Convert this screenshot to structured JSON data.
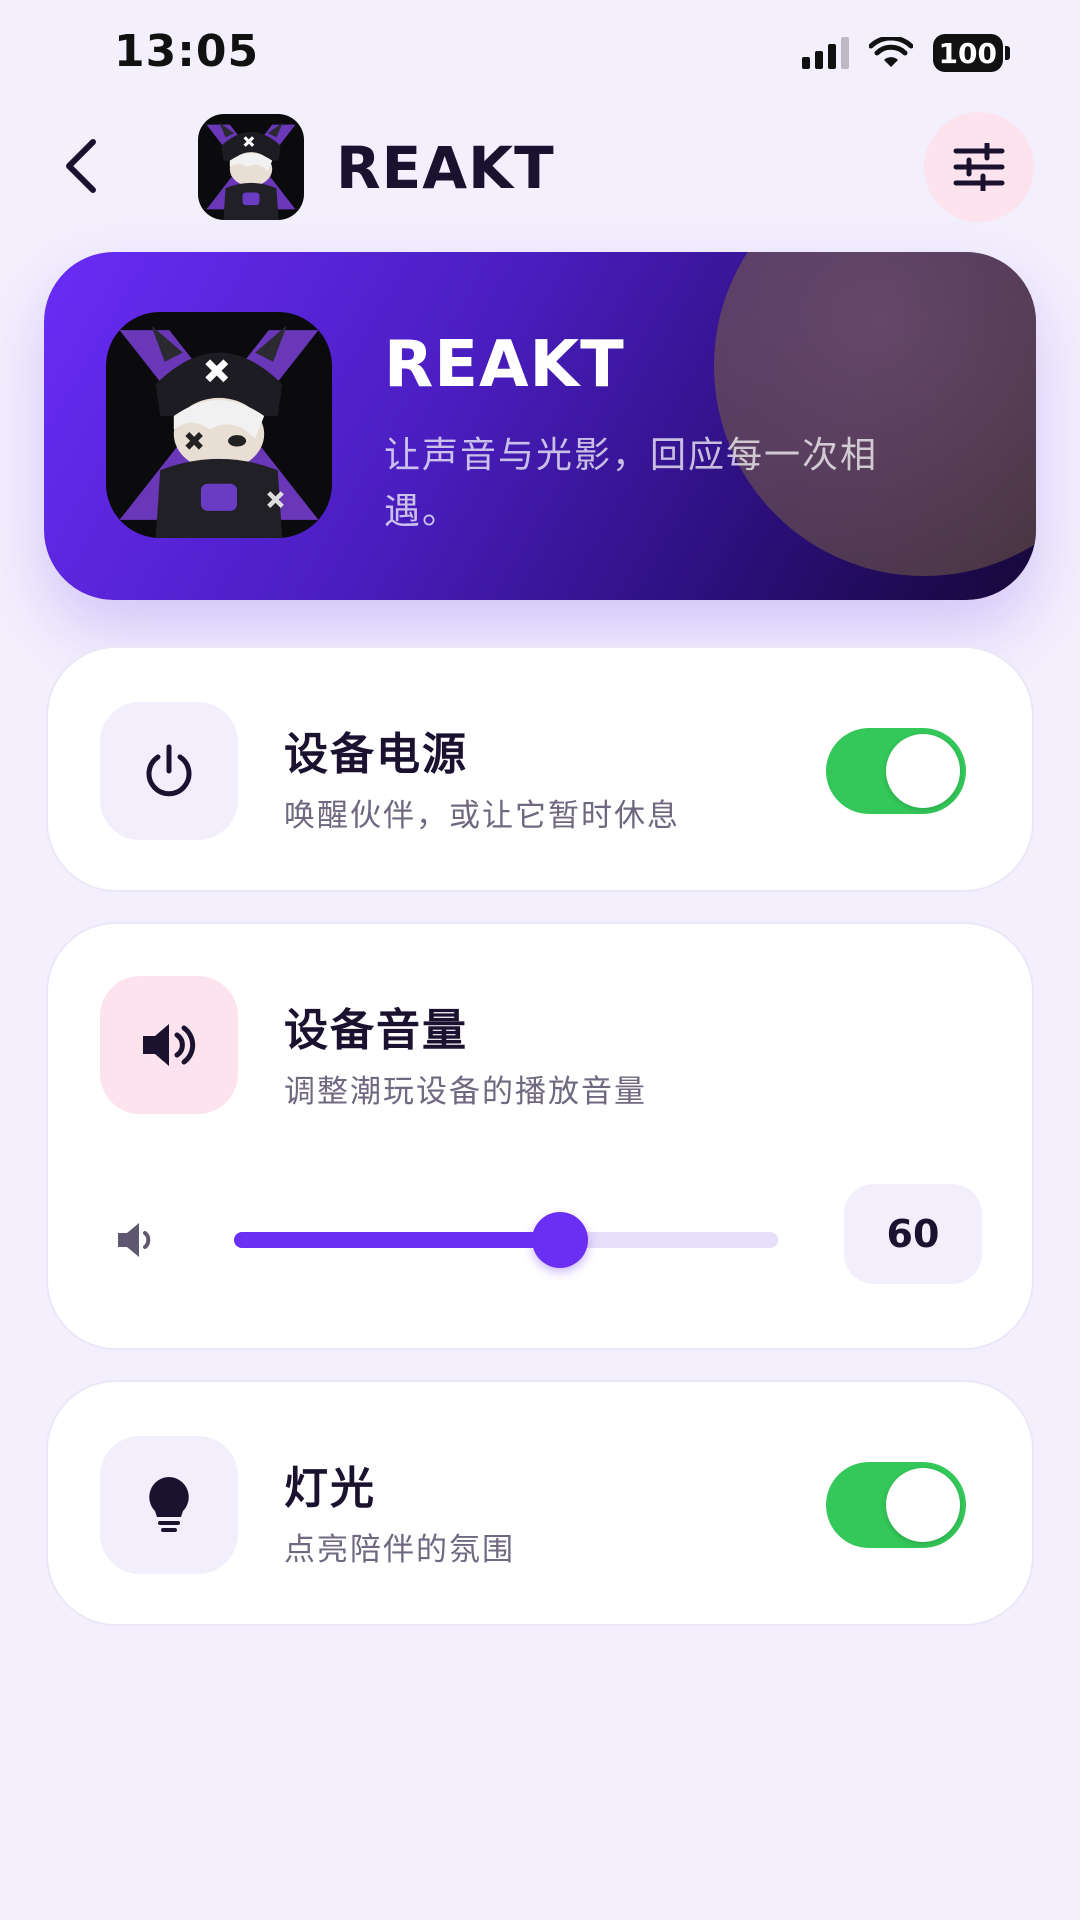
{
  "status_bar": {
    "time": "13:05",
    "battery": "100"
  },
  "header": {
    "title": "REAKT"
  },
  "hero": {
    "title": "REAKT",
    "subtitle": "让声音与光影，回应每一次相遇。"
  },
  "cards": {
    "power": {
      "title": "设备电源",
      "description": "唤醒伙伴，或让它暂时休息",
      "enabled": true
    },
    "volume": {
      "title": "设备音量",
      "description": "调整潮玩设备的播放音量",
      "value": "60",
      "level_percent": 60
    },
    "light": {
      "title": "灯光",
      "description": "点亮陪伴的氛围",
      "enabled": true
    }
  },
  "icons": {
    "back": "chevron-left-icon",
    "settings": "sliders-icon",
    "power": "power-icon",
    "volume": "speaker-icon",
    "volume_small": "speaker-low-icon",
    "light": "lightbulb-icon"
  },
  "colors": {
    "accent": "#6b2ef3",
    "toggle_on": "#34c759",
    "background": "#f3effd",
    "settings_button": "#fde3ee",
    "volume_icon_box": "#fde3ee",
    "icon_box": "#f2eefc"
  }
}
